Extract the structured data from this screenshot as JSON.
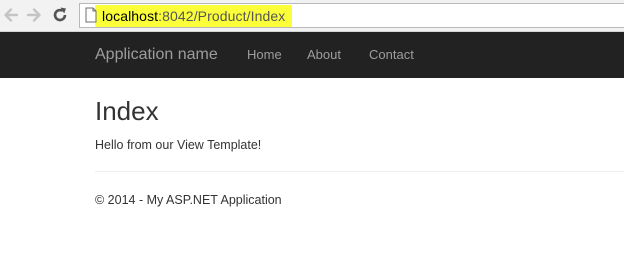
{
  "browser": {
    "address_bar": {
      "url_host": "localhost",
      "url_rest": ":8042/Product/Index",
      "highlight_color": "#fbff3a"
    },
    "icons": [
      "back-arrow-icon",
      "forward-arrow-icon",
      "reload-icon",
      "page-icon"
    ]
  },
  "navbar": {
    "brand": "Application name",
    "links": [
      {
        "label": "Home"
      },
      {
        "label": "About"
      },
      {
        "label": "Contact"
      }
    ],
    "background_color": "#222222",
    "text_color": "#9d9d9d"
  },
  "main": {
    "title": "Index",
    "message": "Hello from our View Template!"
  },
  "footer": {
    "text": "© 2014 - My ASP.NET Application"
  }
}
